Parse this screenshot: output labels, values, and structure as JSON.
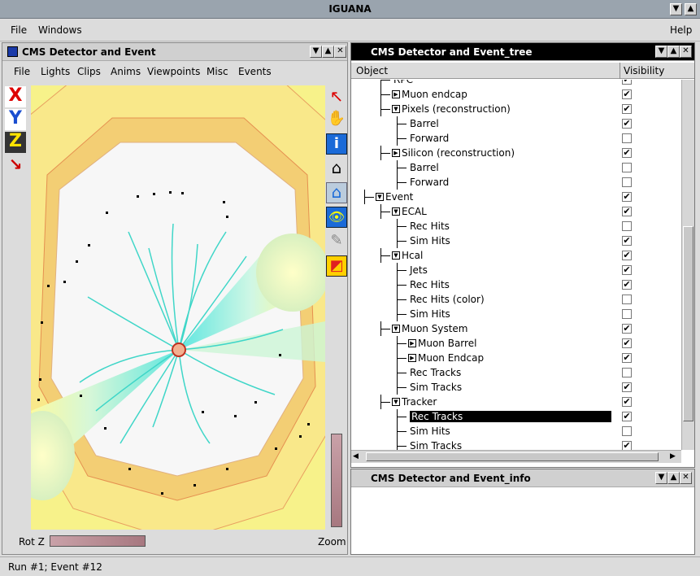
{
  "app": {
    "title": "IGUANA"
  },
  "menubar": {
    "file": "File",
    "windows": "Windows",
    "help": "Help"
  },
  "window_buttons": {
    "down": "▼",
    "up": "▲",
    "close": "✕"
  },
  "viewer": {
    "title": "CMS Detector and Event",
    "menu": [
      "File",
      "Lights",
      "Clips",
      "Anims",
      "Viewpoints",
      "Misc",
      "Events"
    ],
    "left_tools": [
      "x-axis-icon",
      "y-axis-icon",
      "z-axis-icon",
      "arrow-axis-icon"
    ],
    "left_tool_glyphs": [
      "X",
      "Y",
      "Z",
      "↘"
    ],
    "right_tools": [
      "select-arrow-icon",
      "hand-icon",
      "info-icon",
      "home-icon",
      "set-home-icon",
      "eye-icon",
      "light-icon",
      "color-icon"
    ],
    "right_tool_glyphs": [
      "↖",
      "✋",
      "i",
      "⌂",
      "⌂",
      "👁",
      "✎",
      "◩"
    ],
    "rot_label": "Rot Z",
    "zoom_label": "Zoom"
  },
  "tree": {
    "title": "CMS Detector and Event_tree",
    "columns": {
      "object": "Object",
      "visibility": "Visibility"
    },
    "rows": [
      {
        "label": "RPC",
        "level": 2,
        "expander": "",
        "checked": true
      },
      {
        "label": "Muon endcap",
        "level": 2,
        "expander": "▶",
        "checked": true
      },
      {
        "label": "Pixels (reconstruction)",
        "level": 2,
        "expander": "▼",
        "checked": true
      },
      {
        "label": "Barrel",
        "level": 3,
        "expander": "",
        "checked": true
      },
      {
        "label": "Forward",
        "level": 3,
        "expander": "",
        "checked": false
      },
      {
        "label": "Silicon (reconstruction)",
        "level": 2,
        "expander": "▶",
        "checked": true
      },
      {
        "label": "Barrel",
        "level": 3,
        "expander": "",
        "checked": false
      },
      {
        "label": "Forward",
        "level": 3,
        "expander": "",
        "checked": false
      },
      {
        "label": "Event",
        "level": 1,
        "expander": "▼",
        "checked": true
      },
      {
        "label": "ECAL",
        "level": 2,
        "expander": "▼",
        "checked": true
      },
      {
        "label": "Rec Hits",
        "level": 3,
        "expander": "",
        "checked": false
      },
      {
        "label": "Sim Hits",
        "level": 3,
        "expander": "",
        "checked": true
      },
      {
        "label": "Hcal",
        "level": 2,
        "expander": "▼",
        "checked": true
      },
      {
        "label": "Jets",
        "level": 3,
        "expander": "",
        "checked": true
      },
      {
        "label": "Rec Hits",
        "level": 3,
        "expander": "",
        "checked": true
      },
      {
        "label": "Rec Hits (color)",
        "level": 3,
        "expander": "",
        "checked": false
      },
      {
        "label": "Sim Hits",
        "level": 3,
        "expander": "",
        "checked": false
      },
      {
        "label": "Muon System",
        "level": 2,
        "expander": "▼",
        "checked": true
      },
      {
        "label": "Muon Barrel",
        "level": 3,
        "expander": "▶",
        "checked": true
      },
      {
        "label": "Muon Endcap",
        "level": 3,
        "expander": "▶",
        "checked": true
      },
      {
        "label": "Rec Tracks",
        "level": 3,
        "expander": "",
        "checked": false
      },
      {
        "label": "Sim Tracks",
        "level": 3,
        "expander": "",
        "checked": true
      },
      {
        "label": "Tracker",
        "level": 2,
        "expander": "▼",
        "checked": true
      },
      {
        "label": "Rec Tracks",
        "level": 3,
        "expander": "",
        "checked": true,
        "selected": true
      },
      {
        "label": "Sim Hits",
        "level": 3,
        "expander": "",
        "checked": false
      },
      {
        "label": "Sim Tracks",
        "level": 3,
        "expander": "",
        "checked": true
      }
    ]
  },
  "info": {
    "title": "CMS Detector and Event_info"
  },
  "status": {
    "text": "Run #1; Event #12"
  },
  "colors": {
    "titlebar": "#9aa4ae",
    "tracks": "#3fd6c8",
    "endcap": "#f5ec7a",
    "ring": "#f2cf7c",
    "selection": "#000000"
  }
}
